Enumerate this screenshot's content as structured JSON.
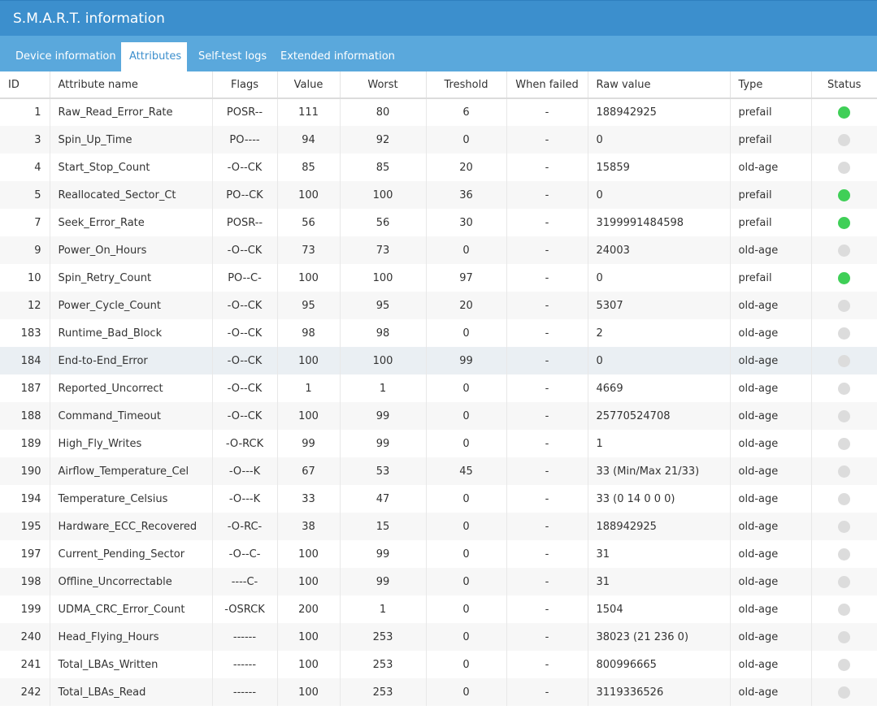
{
  "window": {
    "title": "S.M.A.R.T. information"
  },
  "tabs": [
    {
      "label": "Device information"
    },
    {
      "label": "Attributes"
    },
    {
      "label": "Self-test logs"
    },
    {
      "label": "Extended information"
    }
  ],
  "colors": {
    "ok": "#3fcf57",
    "neutral": "#dcdcdc",
    "accent": "#3c8fcd"
  },
  "table": {
    "headers": [
      "ID",
      "Attribute name",
      "Flags",
      "Value",
      "Worst",
      "Treshold",
      "When failed",
      "Raw value",
      "Type",
      "Status"
    ],
    "rows": [
      {
        "id": "1",
        "name": "Raw_Read_Error_Rate",
        "flags": "POSR--",
        "value": "111",
        "worst": "80",
        "threshold": "6",
        "when_failed": "-",
        "raw": "188942925",
        "type": "prefail",
        "status": "ok"
      },
      {
        "id": "3",
        "name": "Spin_Up_Time",
        "flags": "PO----",
        "value": "94",
        "worst": "92",
        "threshold": "0",
        "when_failed": "-",
        "raw": "0",
        "type": "prefail",
        "status": "neutral"
      },
      {
        "id": "4",
        "name": "Start_Stop_Count",
        "flags": "-O--CK",
        "value": "85",
        "worst": "85",
        "threshold": "20",
        "when_failed": "-",
        "raw": "15859",
        "type": "old-age",
        "status": "neutral"
      },
      {
        "id": "5",
        "name": "Reallocated_Sector_Ct",
        "flags": "PO--CK",
        "value": "100",
        "worst": "100",
        "threshold": "36",
        "when_failed": "-",
        "raw": "0",
        "type": "prefail",
        "status": "ok"
      },
      {
        "id": "7",
        "name": "Seek_Error_Rate",
        "flags": "POSR--",
        "value": "56",
        "worst": "56",
        "threshold": "30",
        "when_failed": "-",
        "raw": "3199991484598",
        "type": "prefail",
        "status": "ok"
      },
      {
        "id": "9",
        "name": "Power_On_Hours",
        "flags": "-O--CK",
        "value": "73",
        "worst": "73",
        "threshold": "0",
        "when_failed": "-",
        "raw": "24003",
        "type": "old-age",
        "status": "neutral"
      },
      {
        "id": "10",
        "name": "Spin_Retry_Count",
        "flags": "PO--C-",
        "value": "100",
        "worst": "100",
        "threshold": "97",
        "when_failed": "-",
        "raw": "0",
        "type": "prefail",
        "status": "ok"
      },
      {
        "id": "12",
        "name": "Power_Cycle_Count",
        "flags": "-O--CK",
        "value": "95",
        "worst": "95",
        "threshold": "20",
        "when_failed": "-",
        "raw": "5307",
        "type": "old-age",
        "status": "neutral"
      },
      {
        "id": "183",
        "name": "Runtime_Bad_Block",
        "flags": "-O--CK",
        "value": "98",
        "worst": "98",
        "threshold": "0",
        "when_failed": "-",
        "raw": "2",
        "type": "old-age",
        "status": "neutral"
      },
      {
        "id": "184",
        "name": "End-to-End_Error",
        "flags": "-O--CK",
        "value": "100",
        "worst": "100",
        "threshold": "99",
        "when_failed": "-",
        "raw": "0",
        "type": "old-age",
        "status": "neutral",
        "highlight": true
      },
      {
        "id": "187",
        "name": "Reported_Uncorrect",
        "flags": "-O--CK",
        "value": "1",
        "worst": "1",
        "threshold": "0",
        "when_failed": "-",
        "raw": "4669",
        "type": "old-age",
        "status": "neutral"
      },
      {
        "id": "188",
        "name": "Command_Timeout",
        "flags": "-O--CK",
        "value": "100",
        "worst": "99",
        "threshold": "0",
        "when_failed": "-",
        "raw": "25770524708",
        "type": "old-age",
        "status": "neutral"
      },
      {
        "id": "189",
        "name": "High_Fly_Writes",
        "flags": "-O-RCK",
        "value": "99",
        "worst": "99",
        "threshold": "0",
        "when_failed": "-",
        "raw": "1",
        "type": "old-age",
        "status": "neutral"
      },
      {
        "id": "190",
        "name": "Airflow_Temperature_Cel",
        "flags": "-O---K",
        "value": "67",
        "worst": "53",
        "threshold": "45",
        "when_failed": "-",
        "raw": "33 (Min/Max 21/33)",
        "type": "old-age",
        "status": "neutral"
      },
      {
        "id": "194",
        "name": "Temperature_Celsius",
        "flags": "-O---K",
        "value": "33",
        "worst": "47",
        "threshold": "0",
        "when_failed": "-",
        "raw": "33 (0 14 0 0 0)",
        "type": "old-age",
        "status": "neutral"
      },
      {
        "id": "195",
        "name": "Hardware_ECC_Recovered",
        "flags": "-O-RC-",
        "value": "38",
        "worst": "15",
        "threshold": "0",
        "when_failed": "-",
        "raw": "188942925",
        "type": "old-age",
        "status": "neutral"
      },
      {
        "id": "197",
        "name": "Current_Pending_Sector",
        "flags": "-O--C-",
        "value": "100",
        "worst": "99",
        "threshold": "0",
        "when_failed": "-",
        "raw": "31",
        "type": "old-age",
        "status": "neutral"
      },
      {
        "id": "198",
        "name": "Offline_Uncorrectable",
        "flags": "----C-",
        "value": "100",
        "worst": "99",
        "threshold": "0",
        "when_failed": "-",
        "raw": "31",
        "type": "old-age",
        "status": "neutral"
      },
      {
        "id": "199",
        "name": "UDMA_CRC_Error_Count",
        "flags": "-OSRCK",
        "value": "200",
        "worst": "1",
        "threshold": "0",
        "when_failed": "-",
        "raw": "1504",
        "type": "old-age",
        "status": "neutral"
      },
      {
        "id": "240",
        "name": "Head_Flying_Hours",
        "flags": "------",
        "value": "100",
        "worst": "253",
        "threshold": "0",
        "when_failed": "-",
        "raw": "38023 (21 236 0)",
        "type": "old-age",
        "status": "neutral"
      },
      {
        "id": "241",
        "name": "Total_LBAs_Written",
        "flags": "------",
        "value": "100",
        "worst": "253",
        "threshold": "0",
        "when_failed": "-",
        "raw": "800996665",
        "type": "old-age",
        "status": "neutral"
      },
      {
        "id": "242",
        "name": "Total_LBAs_Read",
        "flags": "------",
        "value": "100",
        "worst": "253",
        "threshold": "0",
        "when_failed": "-",
        "raw": "3119336526",
        "type": "old-age",
        "status": "neutral"
      }
    ]
  }
}
